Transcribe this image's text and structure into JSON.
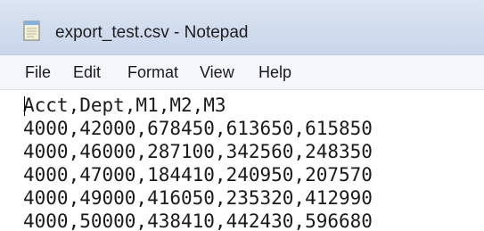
{
  "window": {
    "title": "export_test.csv - Notepad",
    "icon": "notepad-icon"
  },
  "menu": {
    "items": [
      "File",
      "Edit",
      "Format",
      "View",
      "Help"
    ]
  },
  "editor": {
    "lines": [
      "Acct,Dept,M1,M2,M3",
      "4000,42000,678450,613650,615850",
      "4000,46000,287100,342560,248350",
      "4000,47000,184410,240950,207570",
      "4000,49000,416050,235320,412990",
      "4000,50000,438410,442430,596680"
    ]
  }
}
